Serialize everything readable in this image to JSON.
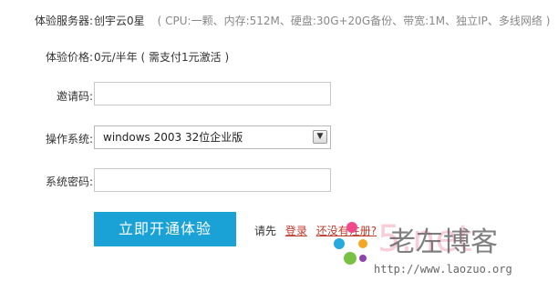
{
  "server": {
    "label": "体验服务器:",
    "name": "创宇云0星",
    "specs": "( CPU:一颗、内存:512M、硬盘:30G+20G备份、带宽:1M、独立IP、多线网络 )"
  },
  "price": {
    "label": "体验价格:",
    "value": "0元/半年 ( 需支付1元激活 )"
  },
  "invite": {
    "label": "邀请码:",
    "value": ""
  },
  "os": {
    "label": "操作系统:",
    "selected": "windows 2003 32位企业版"
  },
  "password": {
    "label": "系统密码:",
    "value": ""
  },
  "submit_label": "立即开通体验",
  "login_prompt": {
    "prefix": "请先",
    "login_link": "登录",
    "register_link": "还没有注册?"
  },
  "watermark": {
    "text": "老左博客",
    "url": "http://www.laozuo.org",
    "accent": "5.net",
    "colors": {
      "pink": "#f04a8c",
      "blue": "#27a9e1",
      "green": "#79c143",
      "orange": "#f5a623",
      "purple": "#8e44ad"
    }
  }
}
